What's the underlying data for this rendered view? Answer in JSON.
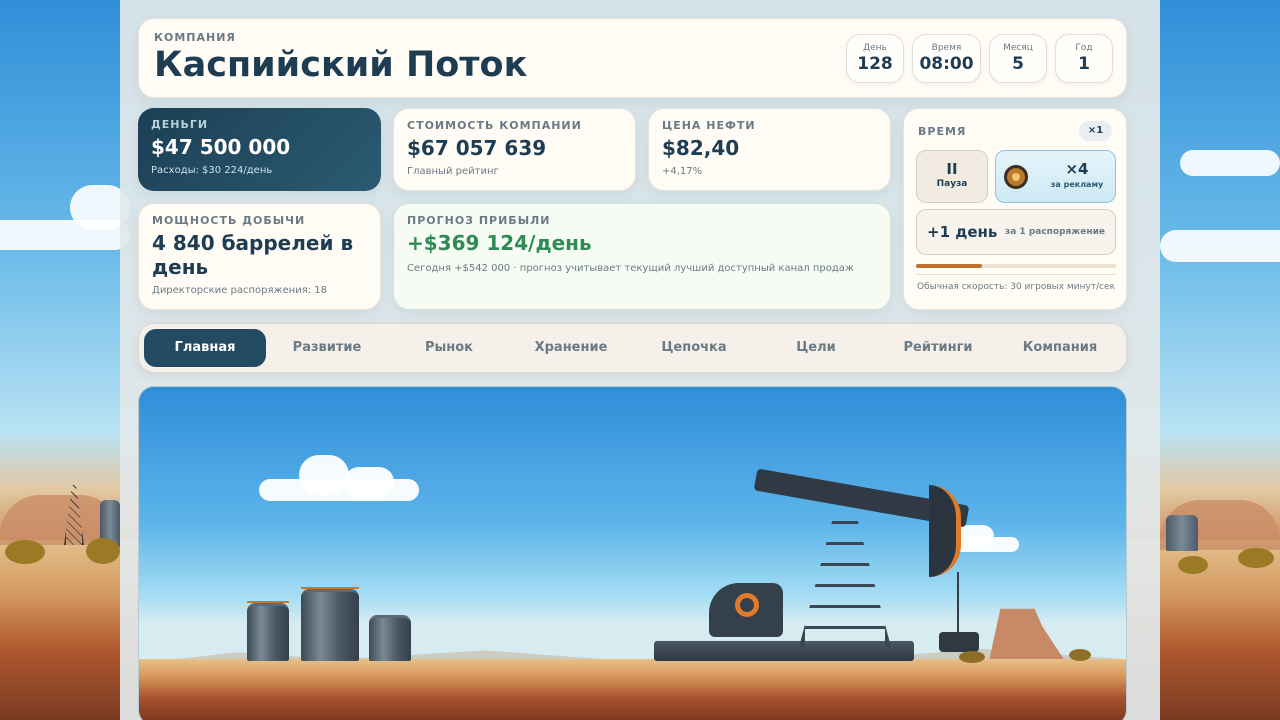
{
  "header": {
    "company_label": "КОМПАНИЯ",
    "company_name": "Каспийский Поток",
    "stats": [
      {
        "label": "День",
        "value": "128"
      },
      {
        "label": "Время",
        "value": "08:00"
      },
      {
        "label": "Месяц",
        "value": "5"
      },
      {
        "label": "Год",
        "value": "1"
      }
    ]
  },
  "cards": {
    "money": {
      "label": "ДЕНЬГИ",
      "value": "$47 500 000",
      "sub": "Расходы: $30 224/день"
    },
    "company_value": {
      "label": "СТОИМОСТЬ КОМПАНИИ",
      "value": "$67 057 639",
      "sub": "Главный рейтинг"
    },
    "oil_price": {
      "label": "ЦЕНА НЕФТИ",
      "value": "$82,40",
      "sub": "+4,17%"
    },
    "production": {
      "label": "МОЩНОСТЬ ДОБЫЧИ",
      "value": "4 840 баррелей в день",
      "sub": "Директорские распоряжения: 18"
    },
    "profit": {
      "label": "ПРОГНОЗ ПРИБЫЛИ",
      "value": "+$369 124/день",
      "sub": "Сегодня +$542 000 · прогноз учитывает текущий лучший доступный канал продаж"
    }
  },
  "time_panel": {
    "label": "ВРЕМЯ",
    "speed": "×1",
    "pause_icon": "II",
    "pause_label": "Пауза",
    "boost_value": "×4",
    "boost_label": "за рекламу",
    "boost_icon": "film-reel-icon",
    "skip_value": "+1 день",
    "skip_label": "за 1 распоряжение",
    "day_progress": 0.33,
    "speed_note": "Обычная скорость: 30 игровых минут/сек"
  },
  "tabs": [
    {
      "label": "Главная",
      "active": true
    },
    {
      "label": "Развитие"
    },
    {
      "label": "Рынок"
    },
    {
      "label": "Хранение"
    },
    {
      "label": "Цепочка"
    },
    {
      "label": "Цели"
    },
    {
      "label": "Рейтинги"
    },
    {
      "label": "Компания"
    }
  ],
  "colors": {
    "primary": "#1f3d52",
    "accent": "#c0702f",
    "profit_green": "#2f8a55",
    "active_tab": "#224b62"
  }
}
